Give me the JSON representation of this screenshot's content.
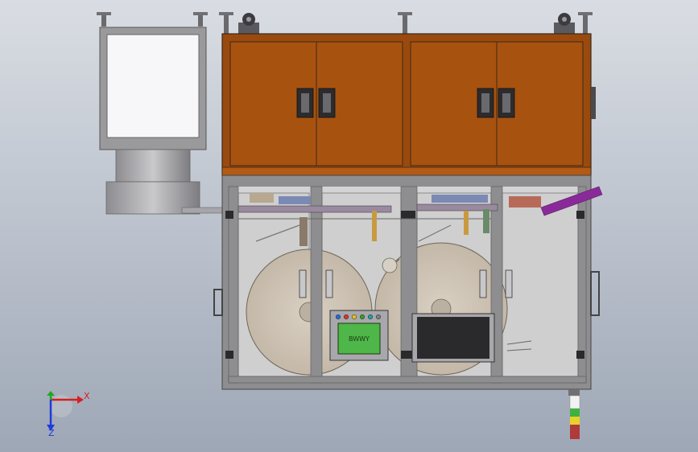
{
  "model": {
    "colors": {
      "background_top": "#d9dde3",
      "background_bottom": "#9ea7b6",
      "cabinet_orange": "#a8520f",
      "frame_gray": "#8e8e90",
      "frame_dark": "#4a4a4c",
      "panel_gray": "#cfcfcf",
      "roll_tan": "#cdc2b4",
      "hmi_green": "#4fb64a",
      "purple_part": "#8a2a9a",
      "signal_green": "#3fb23f",
      "signal_yellow": "#e8d22a",
      "signal_red": "#b03a3a"
    },
    "control_box": {
      "screen_label": "BWWY",
      "indicator_colors": [
        "#2a6ad0",
        "#d03a2a",
        "#e0c020",
        "#30a030",
        "#20a0a0",
        "#808080"
      ]
    },
    "signal_tower": {
      "segments": [
        "green",
        "yellow",
        "red"
      ]
    }
  },
  "triad": {
    "x_label": "X",
    "y_label": "Y",
    "z_label": "Z",
    "x_color": "#d81e1e",
    "y_color": "#1fa81f",
    "z_color": "#1e3cd8"
  }
}
